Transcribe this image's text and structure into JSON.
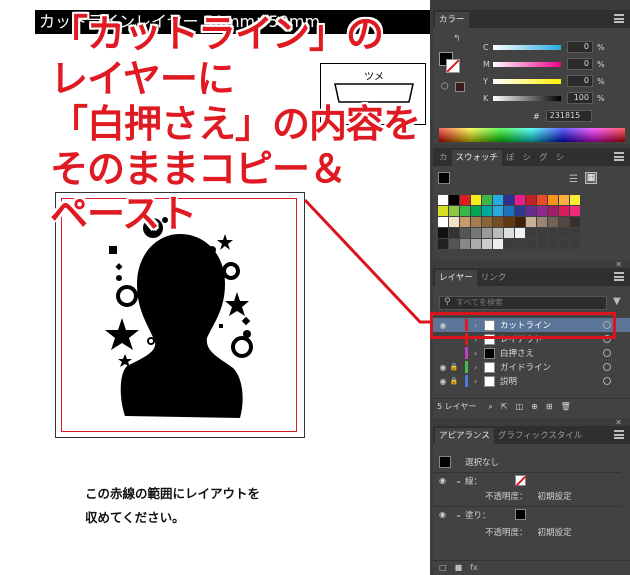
{
  "artboard": {
    "title_text": "カットラインレイヤー 50mm×50mm",
    "tsume_label": "ツメ",
    "note_lines": [
      "この赤線の範囲にレイアウトを",
      "収めてください。"
    ]
  },
  "overlay_lines": [
    "「カットライン」の",
    "レイヤーに",
    "「白押さえ」の内容を",
    "そのままコピー＆",
    "ペースト"
  ],
  "color_panel": {
    "tabs": [
      "カラー"
    ],
    "rows": [
      {
        "label": "C",
        "value": "0",
        "unit": "%",
        "color": "#29abe2"
      },
      {
        "label": "M",
        "value": "0",
        "unit": "%",
        "color": "#ec008c"
      },
      {
        "label": "Y",
        "value": "0",
        "unit": "%",
        "color": "#fff200"
      },
      {
        "label": "K",
        "value": "100",
        "unit": "%",
        "color": "#000000"
      }
    ],
    "hex_label": "#",
    "hex_value": "231815"
  },
  "swatches_panel": {
    "tabs": [
      "カ",
      "スウォッチ",
      "ぼ",
      "シ",
      "グ",
      "シ"
    ]
  },
  "layers_panel": {
    "tabs": [
      "レイヤー",
      "リンク"
    ],
    "search_placeholder": "すべてを検索",
    "layers": [
      {
        "name": "カットライン",
        "color": "#e01a22",
        "eye": "◉",
        "lock": "",
        "selected": true
      },
      {
        "name": "レイアウト",
        "color": "#e01a22",
        "eye": "",
        "lock": "",
        "selected": false
      },
      {
        "name": "白押さえ",
        "color": "#c03cc0",
        "eye": "",
        "lock": "",
        "selected": false
      },
      {
        "name": "ガイドライン",
        "color": "#4cbb4c",
        "eye": "◉",
        "lock": "🔒",
        "selected": false
      },
      {
        "name": "説明",
        "color": "#4c78dd",
        "eye": "◉",
        "lock": "🔒",
        "selected": false
      }
    ],
    "footer_count": "5 レイヤー"
  },
  "appearance_panel": {
    "tabs": [
      "アピアランス",
      "グラフィックスタイル"
    ],
    "selection_label": "選択なし",
    "stroke_label": "線：",
    "opacity_label": "不透明度：",
    "opacity_value": "初期設定",
    "fill_label": "塗り：",
    "opacity2_label": "不透明度：",
    "opacity2_value": "初期設定"
  }
}
